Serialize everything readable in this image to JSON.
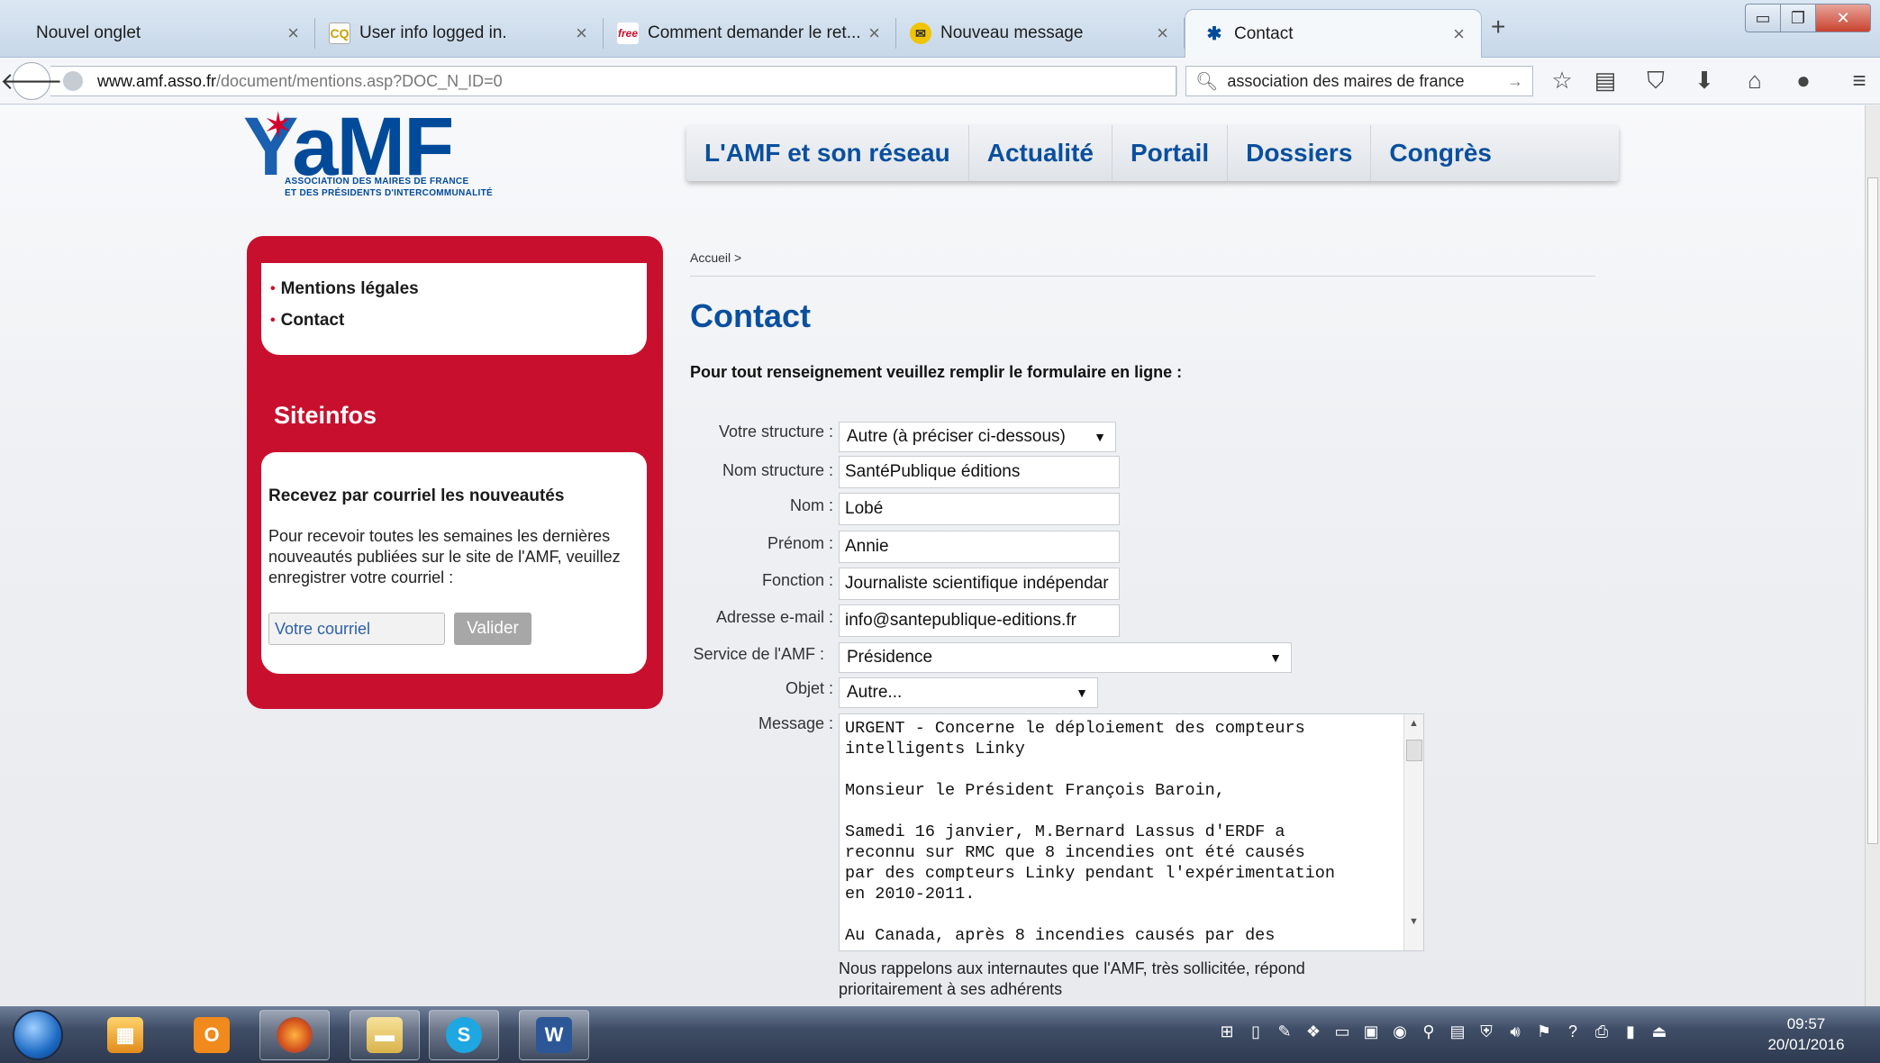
{
  "browser": {
    "tabs": [
      {
        "title": "Nouvel onglet",
        "favicon": "none",
        "active": false
      },
      {
        "title": "User info logged in.",
        "favicon": "cq-icon",
        "active": false
      },
      {
        "title": "Comment demander le ret...",
        "favicon": "free-icon",
        "active": false
      },
      {
        "title": "Nouveau message",
        "favicon": "mail-icon",
        "active": false
      },
      {
        "title": "Contact",
        "favicon": "amf-icon",
        "active": true
      }
    ],
    "url_host": "www.amf.asso.fr",
    "url_path": "/document/mentions.asp?DOC_N_ID=0",
    "search_value": "association des maires de france"
  },
  "site": {
    "logo_text": "aMF",
    "logo_sub1": "ASSOCIATION DES MAIRES DE FRANCE",
    "logo_sub2": "ET DES PRÉSIDENTS D'INTERCOMMUNALITÉ",
    "nav": [
      "L'AMF et son réseau",
      "Actualité",
      "Portail",
      "Dossiers",
      "Congrès"
    ],
    "brand_color": "#c8102e",
    "accent_color": "#0a4f9e"
  },
  "sidebar": {
    "links": [
      "Mentions légales",
      "Contact"
    ],
    "section_title": "Siteinfos",
    "news_title": "Recevez par courriel les nouveautés",
    "news_text": "Pour recevoir toutes les semaines les dernières nouveautés publiées sur le site de l'AMF, veuillez enregistrer votre courriel :",
    "email_placeholder": "Votre courriel",
    "submit_label": "Valider"
  },
  "content": {
    "breadcrumb": "Accueil >",
    "title": "Contact",
    "intro": "Pour tout renseignement veuillez remplir le formulaire en ligne :",
    "form": {
      "structure_label": "Votre structure :",
      "structure_value": "Autre (à préciser ci-dessous)",
      "nom_structure_label": "Nom structure :",
      "nom_structure_value": "SantéPublique éditions",
      "nom_label": "Nom :",
      "nom_value": "Lobé",
      "prenom_label": "Prénom :",
      "prenom_value": "Annie",
      "fonction_label": "Fonction :",
      "fonction_value": "Journaliste scientifique indépendar",
      "email_label": "Adresse e-mail :",
      "email_value": "info@santepublique-editions.fr",
      "service_label": "Service de l'AMF :",
      "service_value": "Présidence",
      "objet_label": "Objet :",
      "objet_value": "Autre...",
      "message_label": "Message :",
      "message_value": "URGENT - Concerne le déploiement des compteurs\nintelligents Linky\n\nMonsieur le Président François Baroin,\n\nSamedi 16 janvier, M.Bernard Lassus d'ERDF a\nreconnu sur RMC que 8 incendies ont été causés\npar des compteurs Linky pendant l'expérimentation\nen 2010-2011.\n\nAu Canada, après 8 incendies causés par des"
    },
    "note": "Nous rappelons aux internautes que l'AMF, très sollicitée, répond prioritairement à ses adhérents"
  },
  "taskbar": {
    "apps": [
      "explorer-icon",
      "outlook-icon",
      "firefox-icon",
      "folder-icon",
      "skype-icon",
      "word-icon"
    ],
    "time": "09:57",
    "date": "20/01/2016"
  }
}
